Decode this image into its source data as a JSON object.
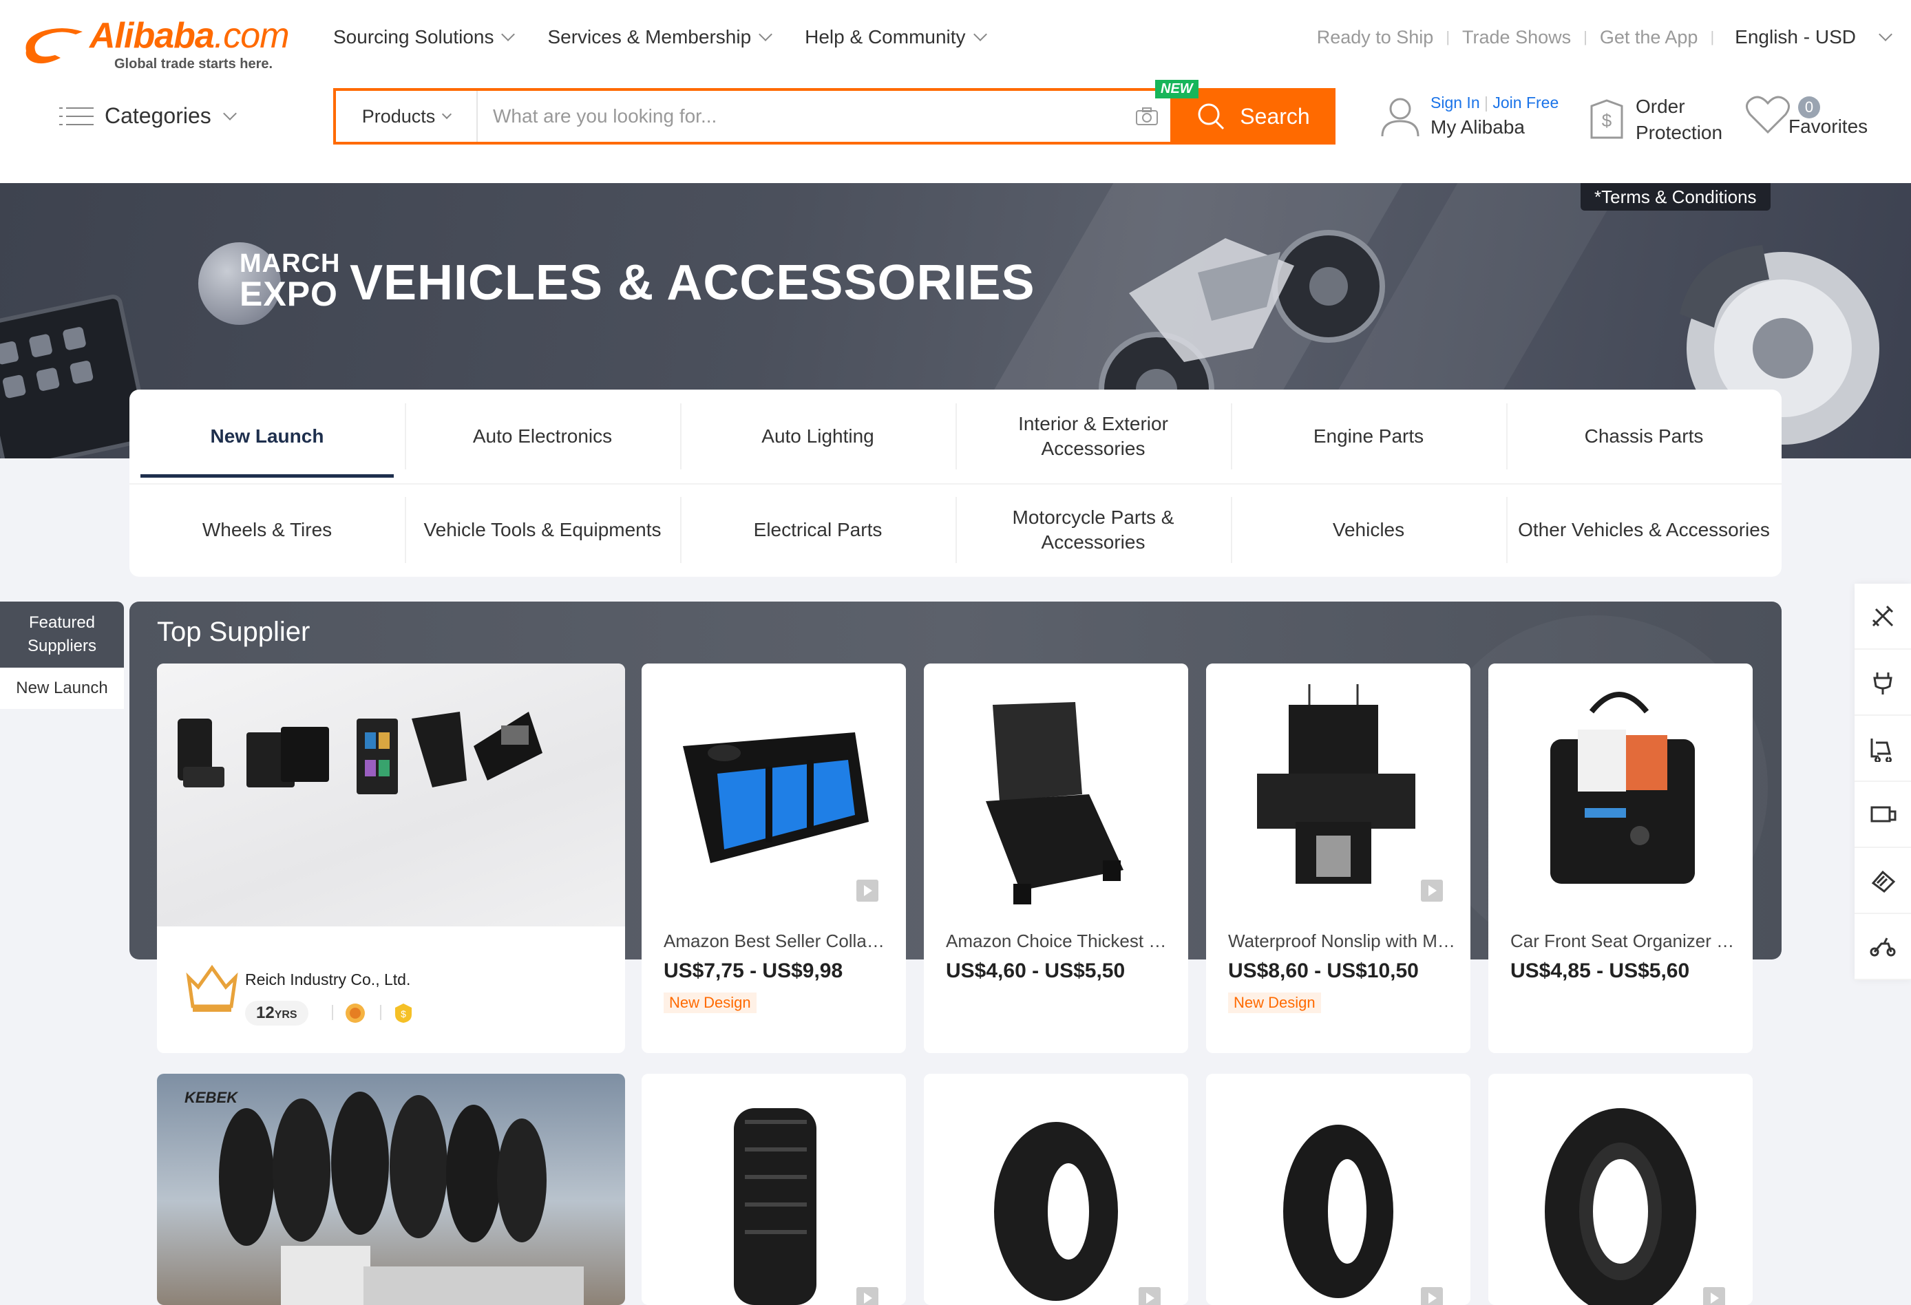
{
  "header": {
    "logo_text": "Alibaba",
    "logo_suffix": ".com",
    "logo_tagline": "Global trade starts here.",
    "nav": [
      "Sourcing Solutions",
      "Services & Membership",
      "Help & Community"
    ],
    "top_links": [
      "Ready to Ship",
      "Trade Shows",
      "Get the App"
    ],
    "language": "English - USD",
    "categories_label": "Categories",
    "search": {
      "category": "Products",
      "placeholder": "What are you looking for...",
      "button": "Search",
      "new_badge": "NEW"
    },
    "account": {
      "sign_in": "Sign In",
      "join_free": "Join Free",
      "my_alibaba": "My Alibaba"
    },
    "order_protection": [
      "Order",
      "Protection"
    ],
    "favorites": {
      "label": "Favorites",
      "count": "0"
    }
  },
  "banner": {
    "expo_line1": "MARCH",
    "expo_line2": "EXPO",
    "title": "VEHICLES & ACCESSORIES",
    "terms": "*Terms & Conditions"
  },
  "category_tabs": [
    [
      "New Launch",
      "Auto Electronics",
      "Auto Lighting",
      "Interior & Exterior Accessories",
      "Engine Parts",
      "Chassis Parts"
    ],
    [
      "Wheels & Tires",
      "Vehicle Tools & Equipments",
      "Electrical Parts",
      "Motorcycle Parts & Accessories",
      "Vehicles",
      "Other Vehicles & Accessories"
    ]
  ],
  "active_tab": "New Launch",
  "side_nav": {
    "featured": "Featured Suppliers",
    "new_launch": "New Launch"
  },
  "side_icons": [
    "tools-icon",
    "plug-icon",
    "forklift-icon",
    "machine-icon",
    "parts-icon",
    "motorbike-icon"
  ],
  "section_title": "Top Supplier",
  "supplier": {
    "name": "Reich Industry Co., Ltd.",
    "years": "12",
    "years_unit": "YRS"
  },
  "products": [
    {
      "name": "Amazon Best Seller Collapsible Car Trunk Organizer",
      "price": "US$7,75 - US$9,98",
      "tag": "New Design",
      "video": true
    },
    {
      "name": "Amazon Choice Thickest Car Seat Protector",
      "price": "US$4,60 - US$5,50",
      "tag": "",
      "video": false
    },
    {
      "name": "Waterproof Nonslip with Mesh Window Dog Seat Cover",
      "price": "US$8,60 - US$10,50",
      "tag": "New Design",
      "video": true
    },
    {
      "name": "Car Front Seat Organizer with Laptop Storage",
      "price": "US$4,85 - US$5,60",
      "tag": "",
      "video": false
    }
  ],
  "second_row": {
    "brand": "KEBEK"
  },
  "colors": {
    "brand": "#ff6a00",
    "active_tab": "#1e2f4d",
    "new_badge": "#17b55a",
    "link": "#1a73e8"
  }
}
